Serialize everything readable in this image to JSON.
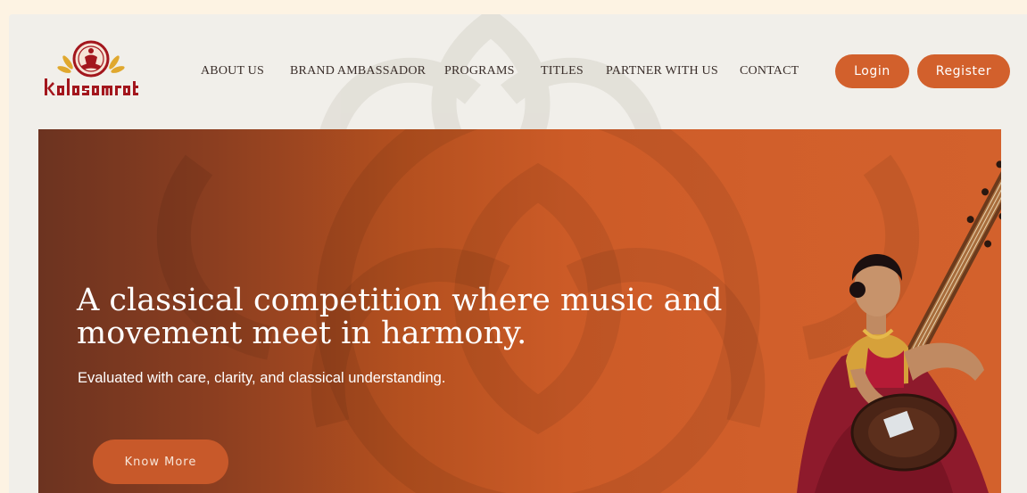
{
  "brand": {
    "logo_text": "kalasamrat"
  },
  "nav": {
    "items": [
      {
        "label": "ABOUT US"
      },
      {
        "label": "BRAND AMBASSADOR"
      },
      {
        "label": "PROGRAMS"
      },
      {
        "label": "TITLES"
      },
      {
        "label": "PARTNER WITH US"
      },
      {
        "label": "CONTACT"
      }
    ]
  },
  "auth": {
    "login_label": "Login",
    "register_label": "Register"
  },
  "hero": {
    "title": "A classical competition where music and movement meet in harmony.",
    "subtitle": "Evaluated with care, clarity, and classical understanding.",
    "cta_label": "Know More"
  },
  "colors": {
    "accent": "#d2602c",
    "page_background": "#f1efea",
    "outer_background": "#fdf3e3",
    "hero_dark": "#6c3320",
    "hero_light": "#d3612c",
    "logo_red": "#a3161d",
    "logo_gold": "#e0a82e"
  }
}
